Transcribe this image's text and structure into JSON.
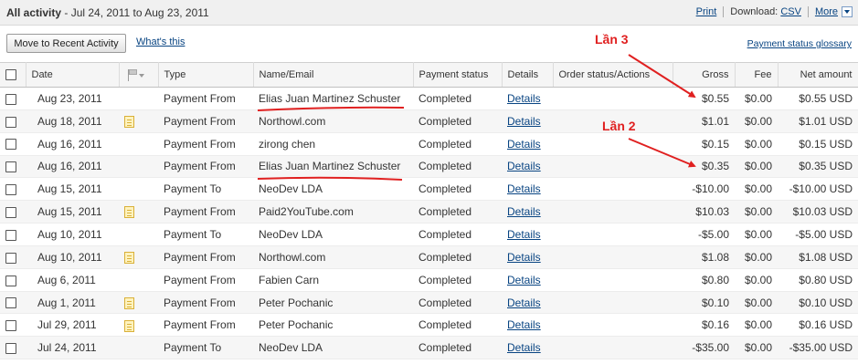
{
  "header": {
    "title_bold": "All activity",
    "title_range": " - Jul 24, 2011 to Aug 23, 2011",
    "print_label": "Print",
    "download_label": "Download:",
    "csv_label": "CSV",
    "more_label": "More"
  },
  "toolbar": {
    "move_button_label": "Move to Recent Activity",
    "whats_this_label": "What's this",
    "glossary_label": "Payment status glossary"
  },
  "table": {
    "columns": {
      "date": "Date",
      "type": "Type",
      "name": "Name/Email",
      "status": "Payment status",
      "details": "Details",
      "order": "Order status/Actions",
      "gross": "Gross",
      "fee": "Fee",
      "net": "Net amount"
    },
    "rows": [
      {
        "date": "Aug 23, 2011",
        "note": false,
        "type": "Payment From",
        "name": "Elias Juan Martinez Schuster",
        "status": "Completed",
        "details": "Details",
        "order": "",
        "gross": "$0.55",
        "fee": "$0.00",
        "net": "$0.55 USD"
      },
      {
        "date": "Aug 18, 2011",
        "note": true,
        "type": "Payment From",
        "name": "Northowl.com",
        "status": "Completed",
        "details": "Details",
        "order": "",
        "gross": "$1.01",
        "fee": "$0.00",
        "net": "$1.01 USD"
      },
      {
        "date": "Aug 16, 2011",
        "note": false,
        "type": "Payment From",
        "name": "zirong chen",
        "status": "Completed",
        "details": "Details",
        "order": "",
        "gross": "$0.15",
        "fee": "$0.00",
        "net": "$0.15 USD"
      },
      {
        "date": "Aug 16, 2011",
        "note": false,
        "type": "Payment From",
        "name": "Elias Juan Martinez Schuster",
        "status": "Completed",
        "details": "Details",
        "order": "",
        "gross": "$0.35",
        "fee": "$0.00",
        "net": "$0.35 USD"
      },
      {
        "date": "Aug 15, 2011",
        "note": false,
        "type": "Payment To",
        "name": "NeoDev LDA",
        "status": "Completed",
        "details": "Details",
        "order": "",
        "gross": "-$10.00",
        "fee": "$0.00",
        "net": "-$10.00 USD"
      },
      {
        "date": "Aug 15, 2011",
        "note": true,
        "type": "Payment From",
        "name": "Paid2YouTube.com",
        "status": "Completed",
        "details": "Details",
        "order": "",
        "gross": "$10.03",
        "fee": "$0.00",
        "net": "$10.03 USD"
      },
      {
        "date": "Aug 10, 2011",
        "note": false,
        "type": "Payment To",
        "name": "NeoDev LDA",
        "status": "Completed",
        "details": "Details",
        "order": "",
        "gross": "-$5.00",
        "fee": "$0.00",
        "net": "-$5.00 USD"
      },
      {
        "date": "Aug 10, 2011",
        "note": true,
        "type": "Payment From",
        "name": "Northowl.com",
        "status": "Completed",
        "details": "Details",
        "order": "",
        "gross": "$1.08",
        "fee": "$0.00",
        "net": "$1.08 USD"
      },
      {
        "date": "Aug 6, 2011",
        "note": false,
        "type": "Payment From",
        "name": "Fabien Carn",
        "status": "Completed",
        "details": "Details",
        "order": "",
        "gross": "$0.80",
        "fee": "$0.00",
        "net": "$0.80 USD"
      },
      {
        "date": "Aug 1, 2011",
        "note": true,
        "type": "Payment From",
        "name": "Peter Pochanic",
        "status": "Completed",
        "details": "Details",
        "order": "",
        "gross": "$0.10",
        "fee": "$0.00",
        "net": "$0.10 USD"
      },
      {
        "date": "Jul 29, 2011",
        "note": true,
        "type": "Payment From",
        "name": "Peter Pochanic",
        "status": "Completed",
        "details": "Details",
        "order": "",
        "gross": "$0.16",
        "fee": "$0.00",
        "net": "$0.16 USD"
      },
      {
        "date": "Jul 24, 2011",
        "note": false,
        "type": "Payment To",
        "name": "NeoDev LDA",
        "status": "Completed",
        "details": "Details",
        "order": "",
        "gross": "-$35.00",
        "fee": "$0.00",
        "net": "-$35.00 USD"
      }
    ]
  },
  "annotations": {
    "label_3": "Lần 3",
    "label_2": "Lần 2",
    "color": "#e02020"
  },
  "colors": {
    "link": "#084482",
    "header_bg": "#f0f0f0",
    "alt_row": "#f6f6f6",
    "note_icon": "#fff3bf"
  }
}
